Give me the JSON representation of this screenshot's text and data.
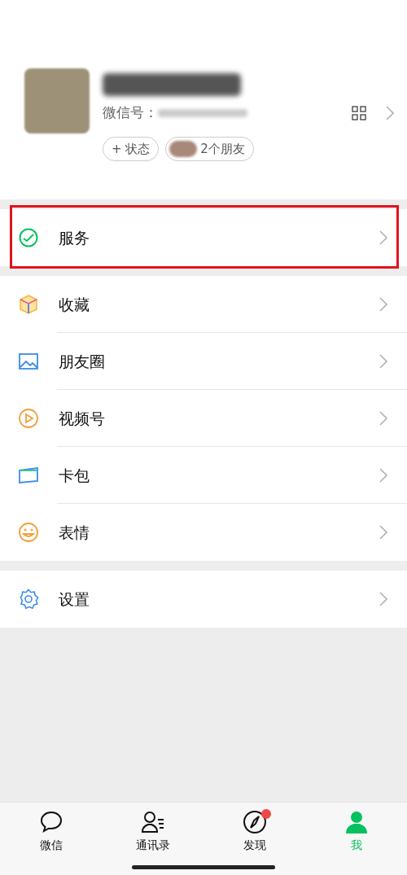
{
  "profile": {
    "wechat_id_label": "微信号：",
    "status_button": "+ 状态",
    "friends_label": "2个朋友"
  },
  "groups": [
    {
      "items": [
        {
          "kind": "service",
          "label": "服务",
          "highlighted": true
        }
      ]
    },
    {
      "items": [
        {
          "kind": "favorites",
          "label": "收藏",
          "highlighted": false
        },
        {
          "kind": "moments",
          "label": "朋友圈",
          "highlighted": false
        },
        {
          "kind": "channels",
          "label": "视频号",
          "highlighted": false
        },
        {
          "kind": "cards",
          "label": "卡包",
          "highlighted": false
        },
        {
          "kind": "stickers",
          "label": "表情",
          "highlighted": false
        }
      ]
    },
    {
      "items": [
        {
          "kind": "settings",
          "label": "设置",
          "highlighted": false
        }
      ]
    }
  ],
  "tabbar": [
    {
      "kind": "chats",
      "label": "微信",
      "selected": false,
      "badge": false
    },
    {
      "kind": "contacts",
      "label": "通讯录",
      "selected": false,
      "badge": false
    },
    {
      "kind": "discover",
      "label": "发现",
      "selected": false,
      "badge": true
    },
    {
      "kind": "me",
      "label": "我",
      "selected": true,
      "badge": false
    }
  ]
}
